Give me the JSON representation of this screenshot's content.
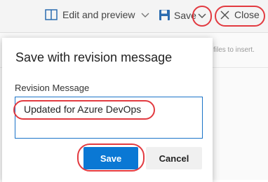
{
  "toolbar": {
    "edit_preview_label": "Edit and preview",
    "save_label": "Save",
    "close_label": "Close"
  },
  "background": {
    "hint_text": "files to insert."
  },
  "dialog": {
    "title": "Save with revision message",
    "field_label": "Revision Message",
    "message_value": "Updated for Azure DevOps",
    "save_button": "Save",
    "cancel_button": "Cancel"
  },
  "colors": {
    "accent": "#0a78d4",
    "highlight": "#e23a40",
    "toolbar_bg": "#f4f4f4"
  },
  "icons": [
    "split-view-icon",
    "chevron-down-icon",
    "floppy-disk-icon",
    "close-icon"
  ]
}
